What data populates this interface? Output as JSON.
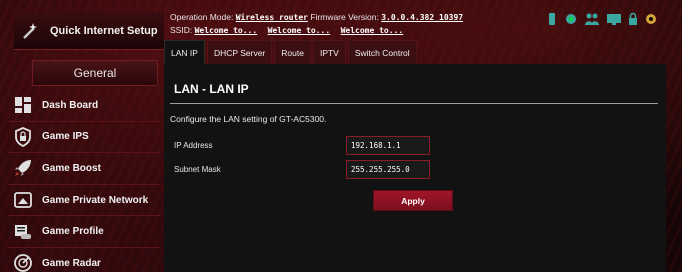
{
  "header": {
    "operation_mode_label": "Operation Mode:",
    "operation_mode_value": "Wireless router",
    "firmware_label": "Firmware Version:",
    "firmware_value": "3.0.0.4.382_10397",
    "ssid_label": "SSID:",
    "ssid_values": [
      "Welcome to...",
      "Welcome to...",
      "Welcome to..."
    ]
  },
  "status_icons": [
    "usb-icon",
    "network-icon",
    "users-icon",
    "monitor-icon",
    "lock-icon",
    "settings-icon"
  ],
  "sidebar": {
    "quick_setup": "Quick Internet Setup",
    "section": "General",
    "items": [
      {
        "label": "Dash Board",
        "icon": "dashboard-icon"
      },
      {
        "label": "Game IPS",
        "icon": "shield-lock-icon"
      },
      {
        "label": "Game Boost",
        "icon": "rocket-icon"
      },
      {
        "label": "Game Private Network",
        "icon": "private-network-icon"
      },
      {
        "label": "Game Profile",
        "icon": "game-profile-icon"
      },
      {
        "label": "Game Radar",
        "icon": "radar-icon"
      }
    ]
  },
  "tabs": [
    "LAN IP",
    "DHCP Server",
    "Route",
    "IPTV",
    "Switch Control"
  ],
  "active_tab": "LAN IP",
  "main": {
    "title": "LAN - LAN IP",
    "description": "Configure the LAN setting of GT-AC5300.",
    "ip_label": "IP Address",
    "ip_value": "192.168.1.1",
    "mask_label": "Subnet Mask",
    "mask_value": "255.255.255.0",
    "apply_label": "Apply"
  },
  "colors": {
    "accent": "#a0152a",
    "panel": "#121212",
    "field_border": "#8a1e24"
  }
}
